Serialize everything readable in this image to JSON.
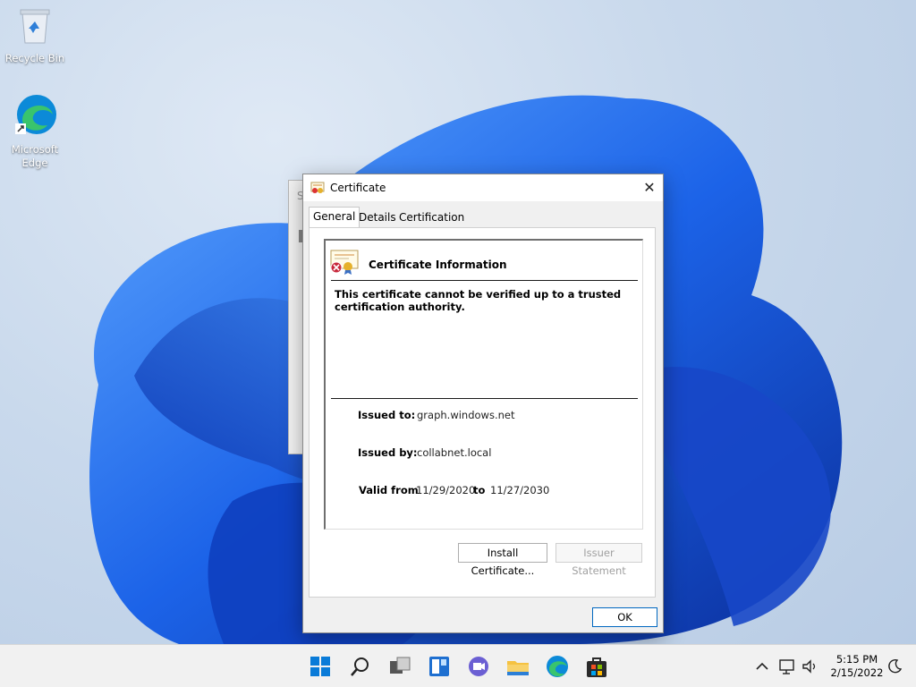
{
  "desktop": {
    "icons": [
      {
        "label": "Recycle Bin",
        "icon": "recycle-bin-icon"
      },
      {
        "label": "Microsoft Edge",
        "icon": "edge-icon"
      }
    ]
  },
  "background_window": {
    "title_fragment": "S"
  },
  "dialog": {
    "title": "Certificate",
    "close_label": "✕",
    "tabs": [
      {
        "label": "General",
        "active": true
      },
      {
        "label": "Details",
        "active": false
      },
      {
        "label": "Certification Path",
        "active": false
      }
    ],
    "info_heading": "Certificate Information",
    "warning": "This certificate cannot be verified up to a trusted certification authority.",
    "issued_to_label": "Issued to:",
    "issued_to_value": "graph.windows.net",
    "issued_by_label": "Issued by:",
    "issued_by_value": "collabnet.local",
    "valid_from_label": "Valid from",
    "valid_from_value": "11/29/2020",
    "valid_to_label": "to",
    "valid_to_value": "11/27/2030",
    "install_button": "Install Certificate...",
    "issuer_button": "Issuer Statement",
    "ok_button": "OK"
  },
  "taskbar": {
    "apps": [
      "start-icon",
      "search-icon",
      "task-view-icon",
      "widgets-icon",
      "chat-icon",
      "file-explorer-icon",
      "edge-icon",
      "store-icon"
    ],
    "time": "5:15 PM",
    "date": "2/15/2022"
  },
  "colors": {
    "accent": "#0067c0",
    "wallpaper_bloom": "#1a5fe0"
  }
}
